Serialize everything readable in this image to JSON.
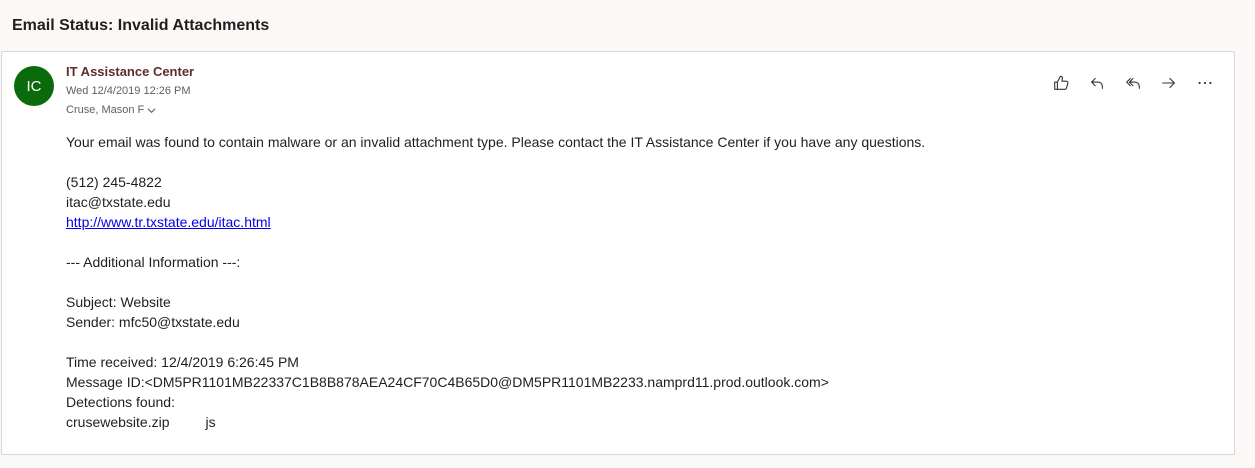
{
  "email": {
    "subject": "Email Status: Invalid Attachments",
    "sender_initials": "IC",
    "sender_name": "IT Assistance Center",
    "sent": "Wed 12/4/2019 12:26 PM",
    "recipient": "Cruse, Mason F",
    "body": {
      "intro": "Your email was found to contain malware or an invalid attachment type. Please contact the IT Assistance Center if you have any questions.",
      "phone": "(512) 245-4822",
      "contact_email": "itac@txstate.edu",
      "link": "http://www.tr.txstate.edu/itac.html",
      "additional_header": "--- Additional Information ---:",
      "subject_line": "Subject: Website",
      "sender_line": "Sender: mfc50@txstate.edu",
      "time_received": "Time received: 12/4/2019 6:26:45 PM",
      "message_id": "Message ID:<DM5PR1101MB22337C1B8B878AEA24CF70C4B65D0@DM5PR1101MB2233.namprd11.prod.outlook.com>",
      "detections_label": "Detections found:",
      "detection_file": "crusewebsite.zip",
      "detection_type": "js"
    }
  },
  "actions": [
    "like-icon",
    "reply-icon",
    "reply-all-icon",
    "forward-icon",
    "more-icon"
  ],
  "colors": {
    "avatar": "#0b6a0b",
    "sender": "#5c2e2e",
    "link": "#0000ee"
  }
}
